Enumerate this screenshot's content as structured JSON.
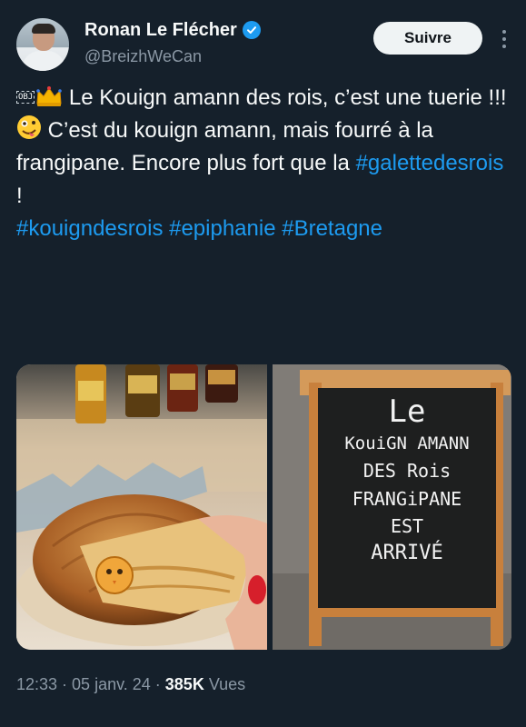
{
  "author": {
    "display_name": "Ronan Le Flécher",
    "handle": "@BreizhWeCan",
    "verified": true
  },
  "actions": {
    "follow_label": "Suivre"
  },
  "tweet": {
    "line1_icon_text": "OBJ",
    "line1_text": " Le Kouign amann des rois, c’est une tuerie !!!",
    "line2_text": " C’est du kouign amann, mais fourré à la frangipane. Encore plus fort que la ",
    "line2_hashtag": "#galettedesrois",
    "line2_end": " !",
    "hashtags": [
      "#kouigndesrois",
      "#epiphanie",
      "#Bretagne"
    ]
  },
  "sign": {
    "line1": "Le",
    "line2": "KouiGN AMANN",
    "line3": "DES Rois",
    "line4": "FRANGiPANE",
    "line5": "EST",
    "line6": "ARRIVÉ"
  },
  "meta": {
    "time": "12:33",
    "sep1": " · ",
    "date": "05 janv. 24",
    "sep2": " · ",
    "views_count": "385K",
    "views_label": " Vues"
  },
  "colors": {
    "background": "#15202b",
    "accent": "#1d9bf0",
    "muted": "#8b98a5"
  }
}
